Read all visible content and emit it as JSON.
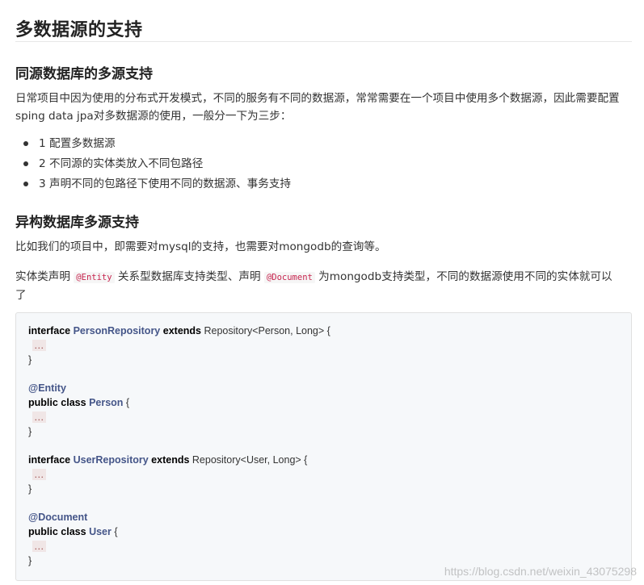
{
  "title": "多数据源的支持",
  "section1": {
    "heading": "同源数据库的多源支持",
    "paragraph": "日常项目中因为使用的分布式开发模式，不同的服务有不同的数据源，常常需要在一个项目中使用多个数据源，因此需要配置sping data jpa对多数据源的使用，一般分一下为三步：",
    "items": [
      "1 配置多数据源",
      "2 不同源的实体类放入不同包路径",
      "3 声明不同的包路径下使用不同的数据源、事务支持"
    ]
  },
  "section2": {
    "heading": "异构数据库多源支持",
    "paragraph1": "比如我们的项目中，即需要对mysql的支持，也需要对mongodb的查询等。",
    "p2_before": "实体类声明 ",
    "p2_code1": "@Entity",
    "p2_middle": " 关系型数据库支持类型、声明 ",
    "p2_code2": "@Document",
    "p2_after": " 为mongodb支持类型，不同的数据源使用不同的实体就可以了"
  },
  "code": {
    "kw_interface": "interface",
    "kw_extends": "extends",
    "kw_public": "public",
    "kw_class": "class",
    "type_person_repo": "PersonRepository",
    "repo_person_generic": " Repository<Person, Long> {",
    "ellipsis": "…",
    "close_brace": "}",
    "ann_entity": "@Entity",
    "type_person": "Person",
    "open_brace": " {",
    "type_user_repo": "UserRepository",
    "repo_user_generic": " Repository<User, Long> {",
    "ann_document": "@Document",
    "type_user": "User"
  },
  "watermark": "https://blog.csdn.net/weixin_43075298"
}
